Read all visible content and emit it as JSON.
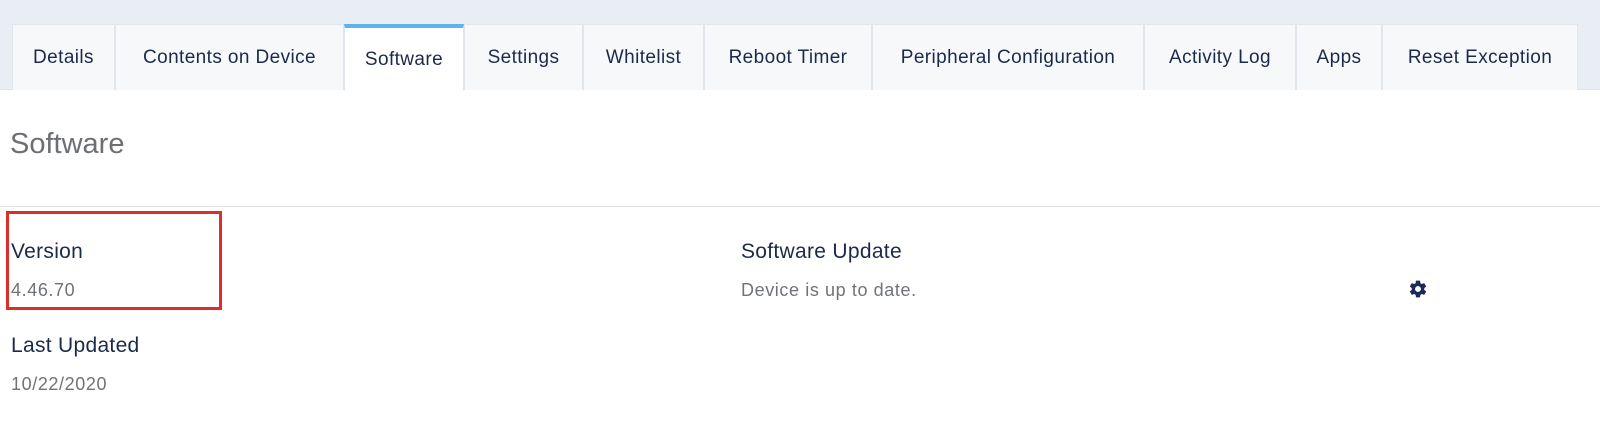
{
  "tabs": [
    {
      "label": "Details"
    },
    {
      "label": "Contents on Device"
    },
    {
      "label": "Software",
      "active": true
    },
    {
      "label": "Settings"
    },
    {
      "label": "Whitelist"
    },
    {
      "label": "Reboot Timer"
    },
    {
      "label": "Peripheral Configuration"
    },
    {
      "label": "Activity Log"
    },
    {
      "label": "Apps"
    },
    {
      "label": "Reset Exception"
    }
  ],
  "page": {
    "title": "Software"
  },
  "version": {
    "label": "Version",
    "value": "4.46.70"
  },
  "last_updated": {
    "label": "Last Updated",
    "value": "10/22/2020"
  },
  "software_update": {
    "label": "Software Update",
    "status": "Device is up to date.",
    "settings_icon": "gear-icon"
  },
  "colors": {
    "accent": "#5db3ee",
    "highlight": "#d9302c",
    "label_text": "#1c2a4a",
    "value_text": "#6f7378",
    "tab_bar_bg": "#e9eef5"
  }
}
